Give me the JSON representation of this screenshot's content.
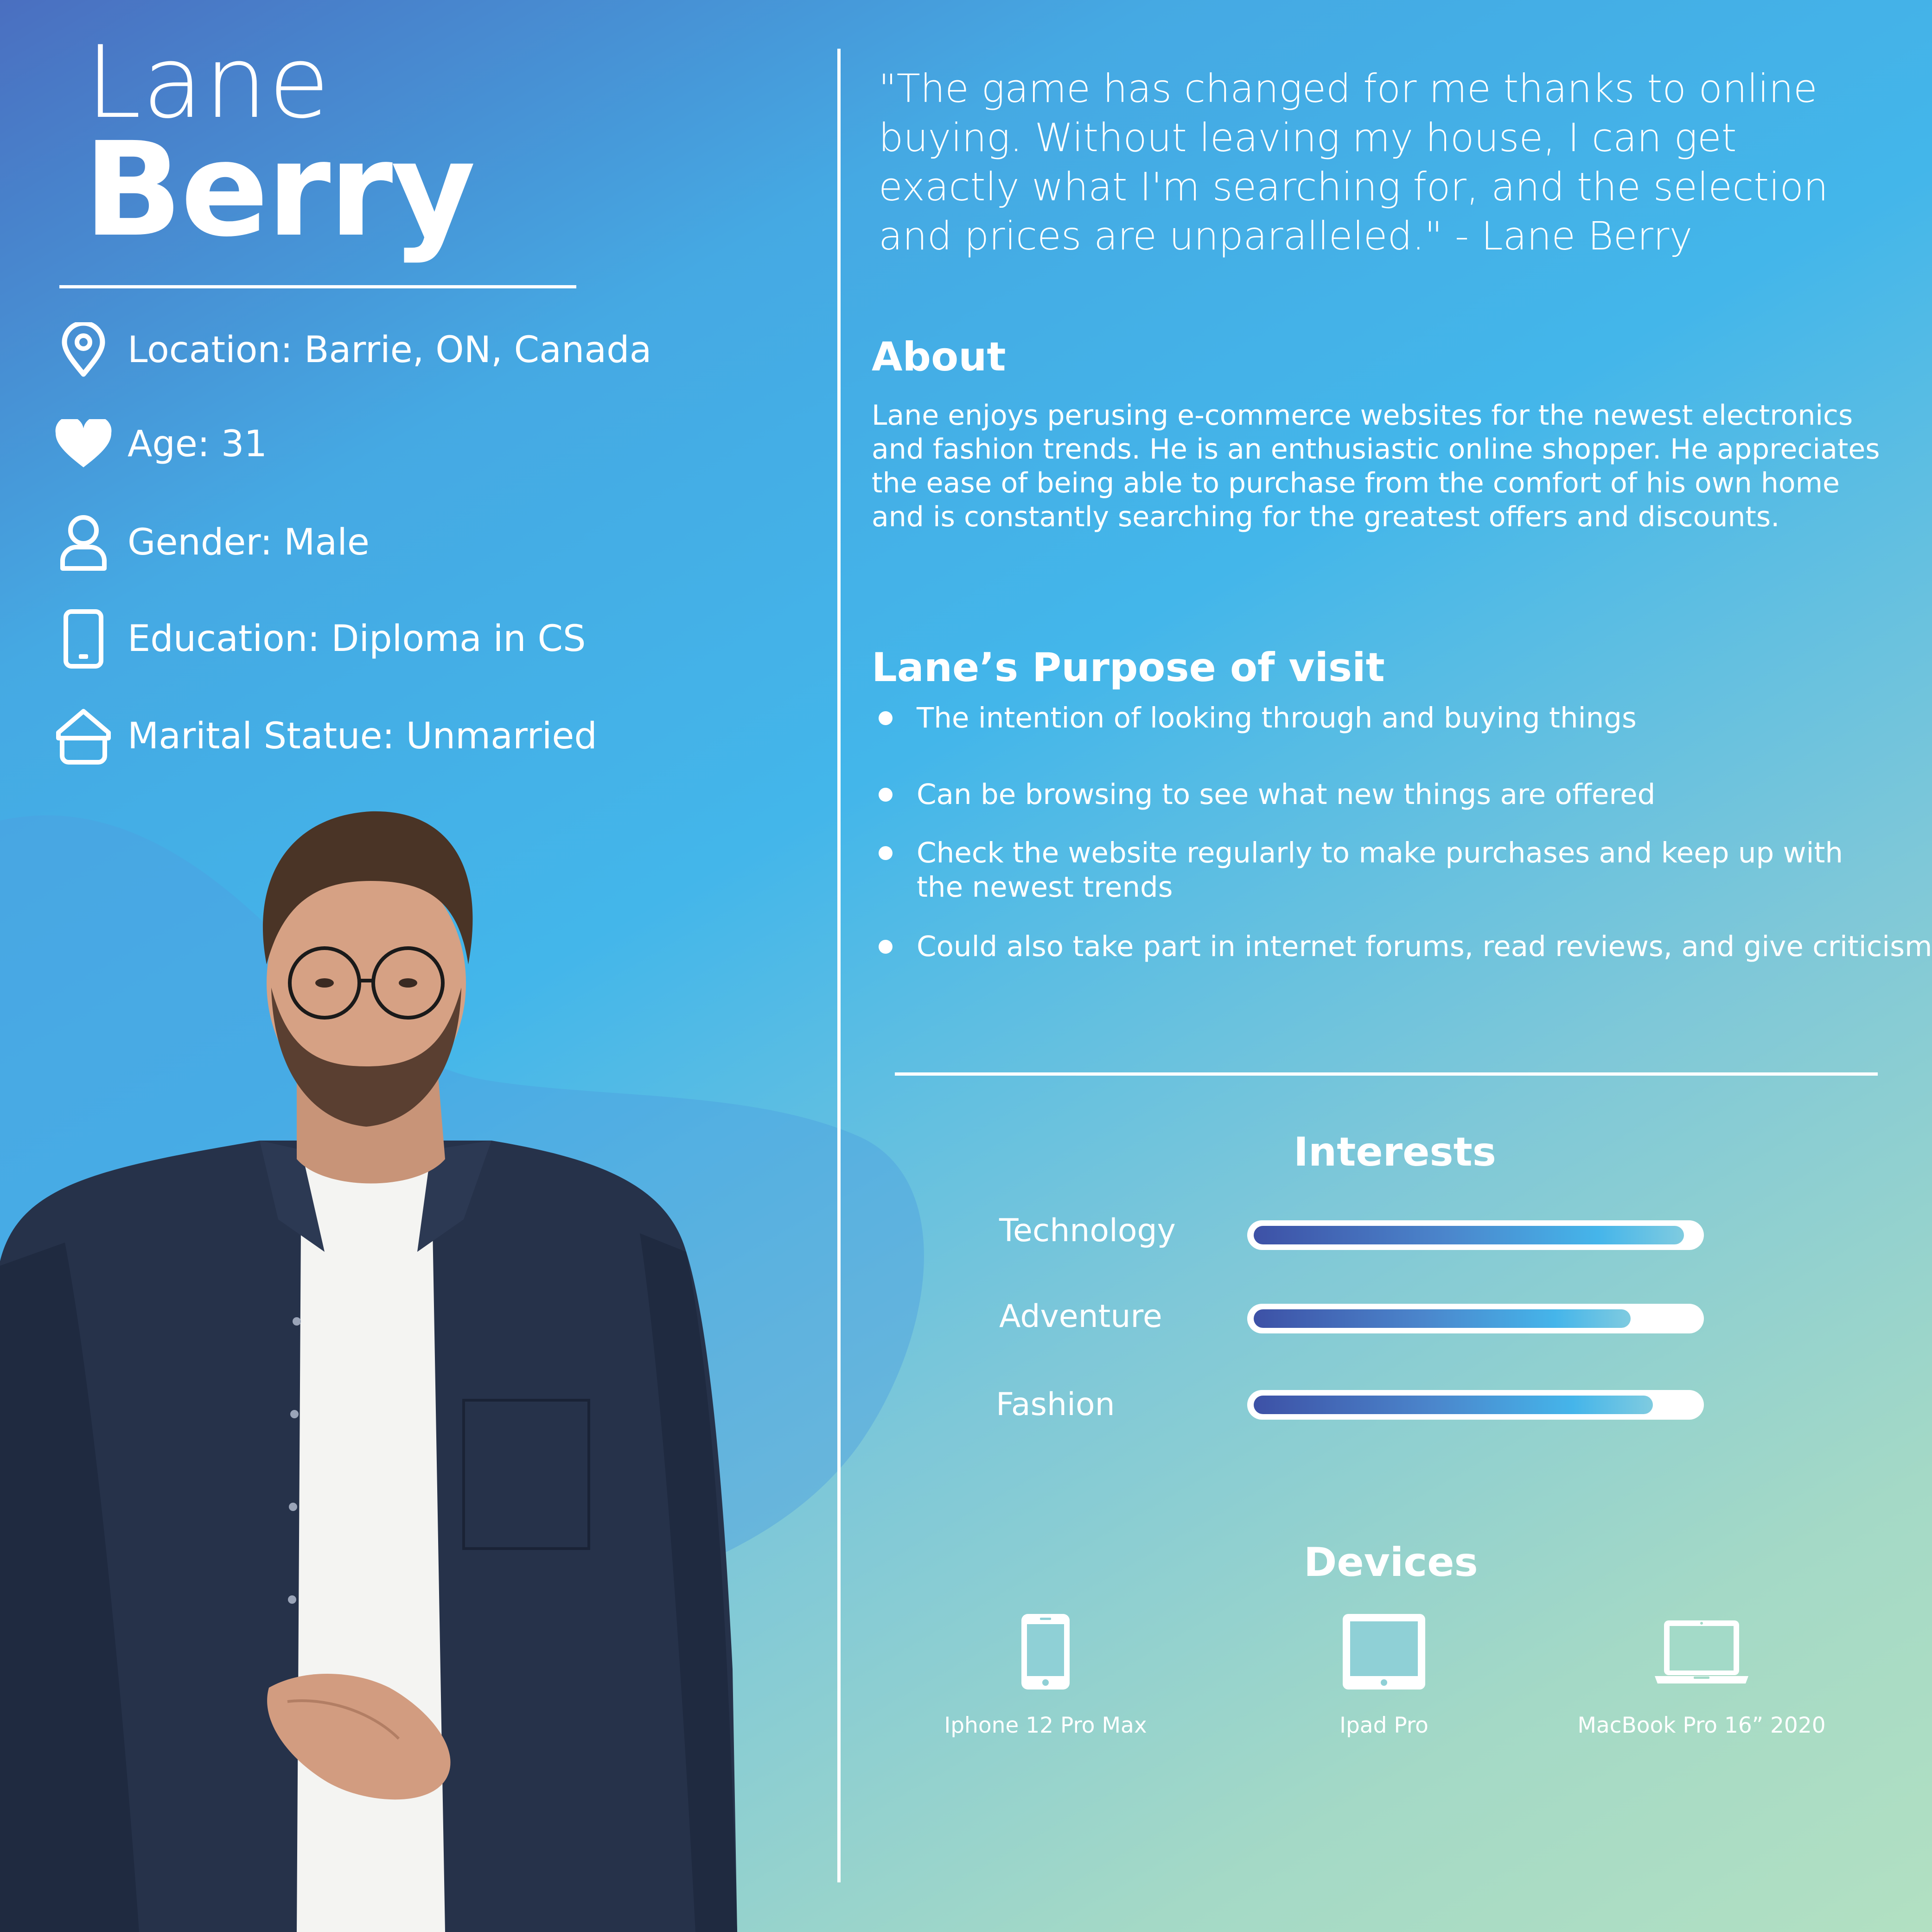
{
  "persona": {
    "first_name": "Lane",
    "last_name": "Berry"
  },
  "details": [
    {
      "icon": "location-pin-icon",
      "text": "Location: Barrie, ON, Canada"
    },
    {
      "icon": "heart-icon",
      "text": "Age: 31"
    },
    {
      "icon": "person-icon",
      "text": "Gender: Male"
    },
    {
      "icon": "phone-icon",
      "text": "Education: Diploma in CS"
    },
    {
      "icon": "house-icon",
      "text": "Marital Statue: Unmarried"
    }
  ],
  "quote": {
    "lines": [
      "\"The game has changed for me thanks to online",
      " buying. Without leaving my house, I can get",
      "exactly what I'm searching for, and the selection",
      "and prices are unparalleled.\" - Lane Berry"
    ]
  },
  "about": {
    "title": "About",
    "lines": [
      "Lane enjoys perusing e-commerce websites for the newest electronics",
      "and fashion trends. He is an enthusiastic online shopper. He appreciates",
      " the ease of being able to purchase from the comfort of his own home",
      "and is constantly searching for the greatest offers and discounts."
    ]
  },
  "purpose": {
    "title": "Lane’s Purpose of visit",
    "items": [
      {
        "lines": [
          "The intention of looking through and buying things"
        ]
      },
      {
        "lines": [
          "Can be browsing to see what new things are offered"
        ]
      },
      {
        "lines": [
          "Check the website regularly to make purchases and keep up with",
          "the newest trends"
        ]
      },
      {
        "lines": [
          "Could also take part in internet forums, read reviews, and give criticism"
        ]
      }
    ]
  },
  "interests": {
    "title": "Interests",
    "items": [
      {
        "label": "Technology",
        "level": 0.97
      },
      {
        "label": "Adventure",
        "level": 0.85
      },
      {
        "label": "Fashion",
        "level": 0.9
      }
    ]
  },
  "devices": {
    "title": "Devices",
    "items": [
      {
        "icon": "smartphone-icon",
        "label": "Iphone 12 Pro Max"
      },
      {
        "icon": "tablet-icon",
        "label": "Ipad Pro"
      },
      {
        "icon": "laptop-icon",
        "label": "MacBook Pro 16” 2020"
      }
    ]
  }
}
